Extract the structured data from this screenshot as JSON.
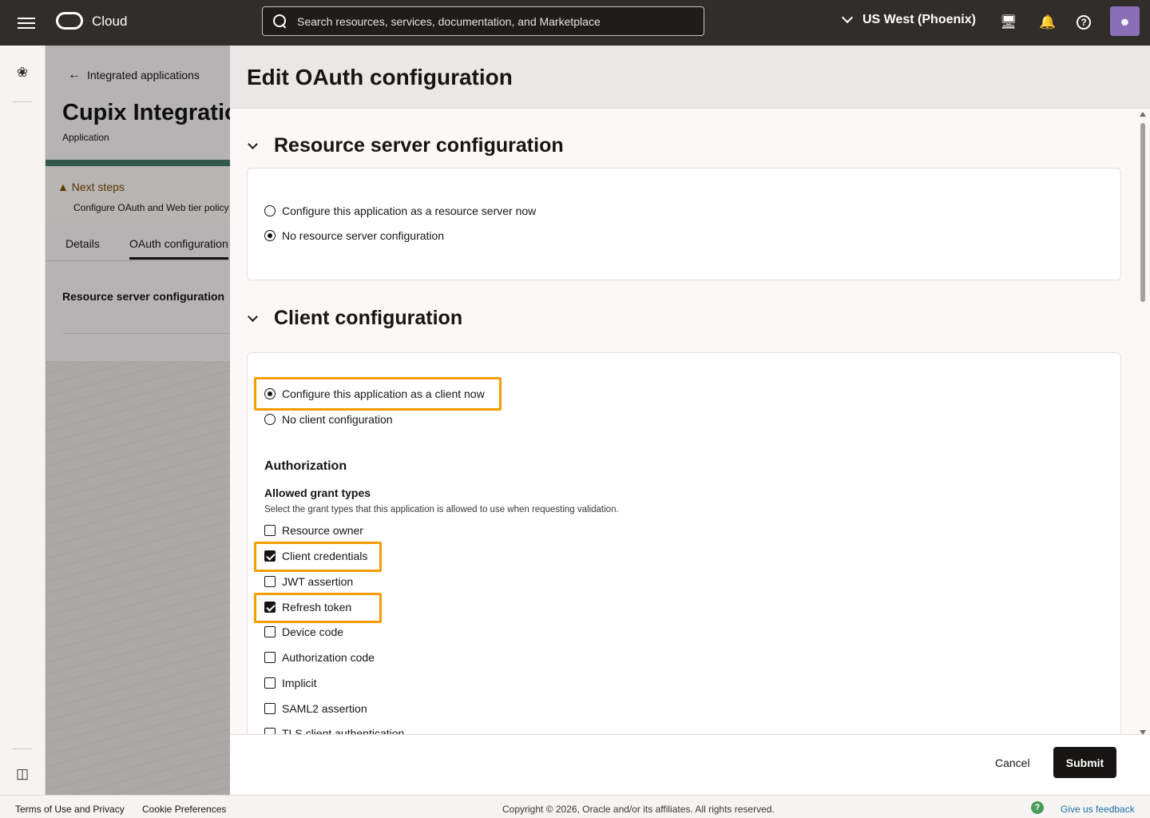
{
  "topbar": {
    "brand": "Cloud",
    "search_placeholder": "Search resources, services, documentation, and Marketplace",
    "region": "US West (Phoenix)"
  },
  "background_page": {
    "back_label": "Integrated applications",
    "title": "Cupix Integration",
    "subtitle": "Application",
    "next_steps_title": "Next steps",
    "next_steps_desc": "Configure OAuth and Web tier policy",
    "tabs": [
      {
        "label": "Details"
      },
      {
        "label": "OAuth configuration"
      }
    ],
    "section_label": "Resource server configuration"
  },
  "drawer": {
    "title": "Edit OAuth configuration",
    "resource_section": {
      "heading": "Resource server configuration",
      "options": [
        {
          "label": "Configure this application as a resource server now",
          "selected": false
        },
        {
          "label": "No resource server configuration",
          "selected": true
        }
      ]
    },
    "client_section": {
      "heading": "Client configuration",
      "options": [
        {
          "label": "Configure this application as a client now",
          "selected": true
        },
        {
          "label": "No client configuration",
          "selected": false
        }
      ],
      "authorization_heading": "Authorization",
      "grant_types_heading": "Allowed grant types",
      "grant_types_desc": "Select the grant types that this application is allowed to use when requesting validation.",
      "grant_types": [
        {
          "label": "Resource owner",
          "checked": false
        },
        {
          "label": "Client credentials",
          "checked": true
        },
        {
          "label": "JWT assertion",
          "checked": false
        },
        {
          "label": "Refresh token",
          "checked": true
        },
        {
          "label": "Device code",
          "checked": false
        },
        {
          "label": "Authorization code",
          "checked": false
        },
        {
          "label": "Implicit",
          "checked": false
        },
        {
          "label": "SAML2 assertion",
          "checked": false
        },
        {
          "label": "TLS client authentication",
          "checked": false
        }
      ]
    },
    "cancel_label": "Cancel",
    "submit_label": "Submit"
  },
  "footer": {
    "terms": "Terms of Use and Privacy",
    "cookies": "Cookie Preferences",
    "copyright": "Copyright © 2026, Oracle and/or its affiliates. All rights reserved.",
    "feedback": "Give us feedback"
  },
  "colors": {
    "highlight": "#f59d00",
    "topbar": "#312d2a",
    "submit": "#161513"
  }
}
